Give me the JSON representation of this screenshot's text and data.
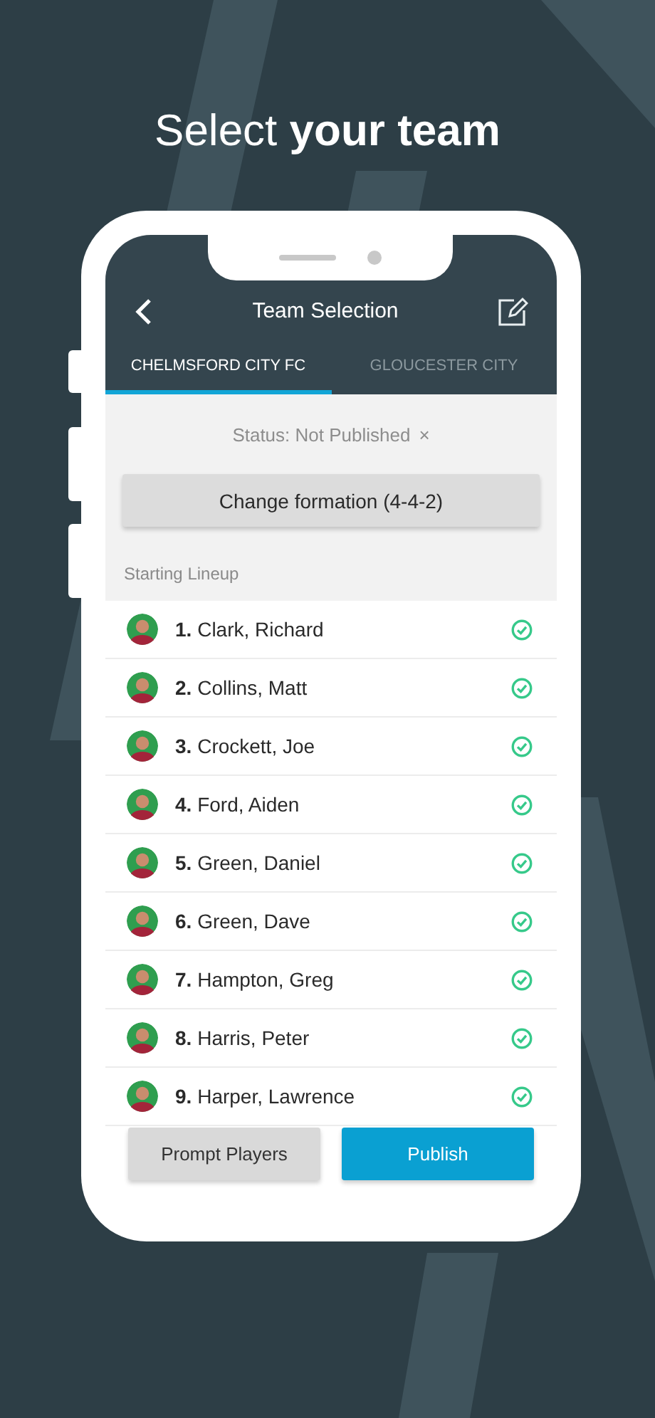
{
  "headline": "Select **your team**",
  "screen": {
    "title": "Team Selection",
    "tabs": [
      {
        "label": "CHELMSFORD CITY FC",
        "selected": true
      },
      {
        "label": "GLOUCESTER CITY",
        "selected": false
      }
    ],
    "status": "Status: Not Published",
    "status_close": "×",
    "formation_button": "Change formation (4-4-2)",
    "section_label": "Starting Lineup",
    "players": [
      {
        "label": "**1.** Clark, Richard",
        "confirmed": true
      },
      {
        "label": "**2.** Collins, Matt",
        "confirmed": true
      },
      {
        "label": "**3.** Crockett, Joe",
        "confirmed": true
      },
      {
        "label": "**4.** Ford, Aiden",
        "confirmed": true
      },
      {
        "label": "**5.** Green, Daniel",
        "confirmed": true
      },
      {
        "label": "**6.** Green, Dave",
        "confirmed": true
      },
      {
        "label": "**7.** Hampton, Greg",
        "confirmed": true
      },
      {
        "label": "**8.** Harris, Peter",
        "confirmed": true
      },
      {
        "label": "**9.** Harper, Lawrence",
        "confirmed": true
      }
    ],
    "buttons": [
      {
        "label": "Prompt Players",
        "kind": "secondary"
      },
      {
        "label": "Publish",
        "kind": "primary"
      }
    ]
  }
}
